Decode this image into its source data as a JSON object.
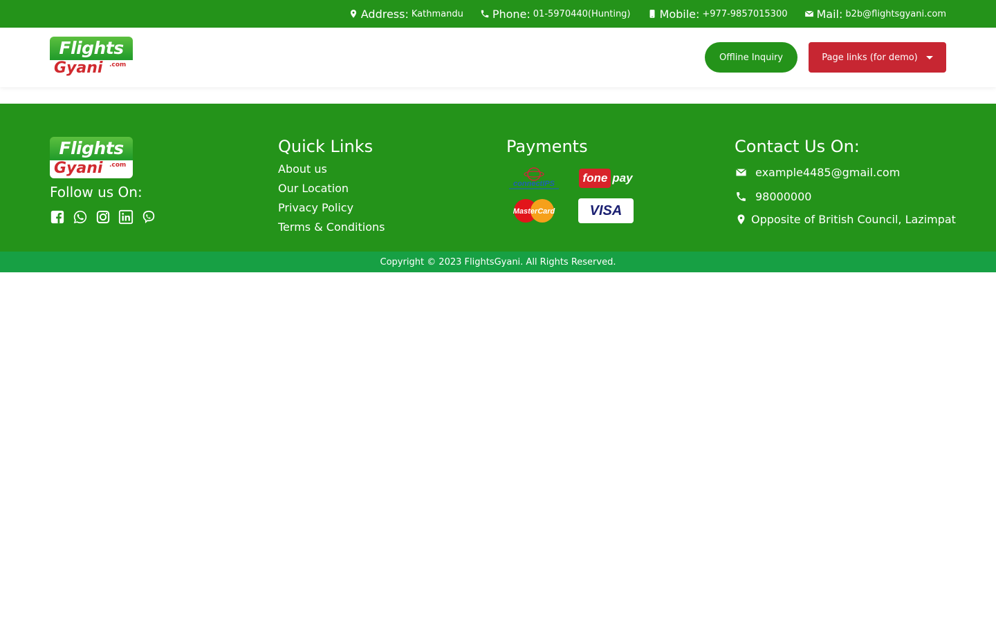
{
  "topbar": {
    "address_key": "Address:",
    "address_val": "Kathmandu",
    "phone_key": "Phone:",
    "phone_val": "01-5970440(Hunting)",
    "mobile_key": "Mobile:",
    "mobile_val": "+977-9857015300",
    "mail_key": "Mail:",
    "mail_val": "b2b@flightsgyani.com"
  },
  "logo": {
    "line1": "Flights",
    "line2": "Gyani",
    "suffix": ".com"
  },
  "header": {
    "offline_label": "Offline Inquiry",
    "pages_label": "Page links (for demo)"
  },
  "footer": {
    "follow_title": "Follow us On:",
    "social": [
      "facebook-icon",
      "whatsapp-icon",
      "instagram-icon",
      "linkedin-icon",
      "viber-icon"
    ],
    "quick_links_title": "Quick Links",
    "quick_links": [
      "About us",
      "Our Location",
      "Privacy Policy",
      "Terms & Conditions"
    ],
    "payments_title": "Payments",
    "payments": {
      "connectips": "connectIPS",
      "fonepay_a": "fone",
      "fonepay_b": "pay",
      "mastercard": "MasterCard",
      "visa": "VISA"
    },
    "contact_title": "Contact Us On:",
    "contact_email": "example4485@gmail.com",
    "contact_phone": "98000000",
    "contact_address": "Opposite of British Council, Lazimpat"
  },
  "copyright": "Copyright © 2023 FlightsGyani. All Rights Reserved.",
  "colors": {
    "brand_green": "#24931a",
    "copyright_green": "#17a044",
    "brand_red": "#c72632"
  }
}
